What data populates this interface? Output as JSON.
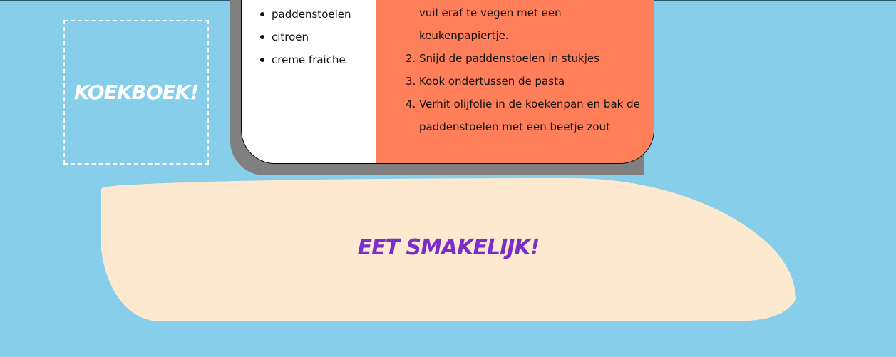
{
  "logo": {
    "title": "KOEKBOEK!"
  },
  "recipe": {
    "ingredients": [
      "paddenstoelen",
      "citroen",
      "creme fraiche"
    ],
    "steps_partial_first": [
      "vuil eraf te vegen met een",
      "keukenpapiertje."
    ],
    "steps": [
      {
        "number": "2.",
        "lines": [
          "Snijd de paddenstoelen in stukjes"
        ]
      },
      {
        "number": "3.",
        "lines": [
          "Kook ondertussen de pasta"
        ]
      },
      {
        "number": "4.",
        "lines": [
          "Verhit olijfolie in de koekenpan en bak de",
          "paddenstoelen met een beetje zout"
        ]
      }
    ]
  },
  "footer": {
    "closing": "EET SMAKELIJK!"
  },
  "colors": {
    "background": "#87ceeb",
    "steps_panel": "#ff7f5a",
    "footer_blob": "#fde9cf",
    "closing_text": "#7a2dc8",
    "shadow": "#808080"
  }
}
